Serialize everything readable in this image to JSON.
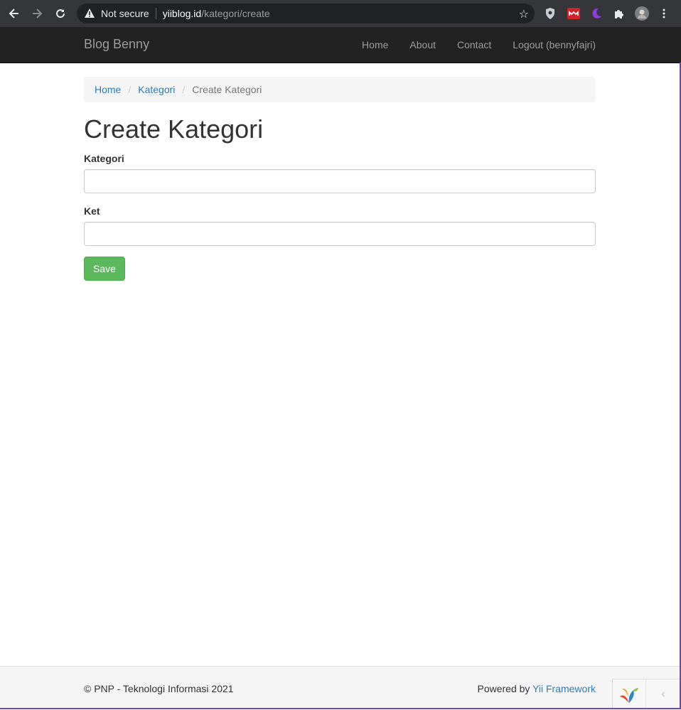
{
  "browser": {
    "security_label": "Not secure",
    "url_host": "yiiblog.id",
    "url_path": "/kategori/create"
  },
  "navbar": {
    "brand": "Blog Benny",
    "links": [
      "Home",
      "About",
      "Contact",
      "Logout (bennyfajri)"
    ]
  },
  "breadcrumb": {
    "items": [
      "Home",
      "Kategori"
    ],
    "active": "Create Kategori"
  },
  "page": {
    "title": "Create Kategori"
  },
  "form": {
    "kategori_label": "Kategori",
    "kategori_value": "",
    "ket_label": "Ket",
    "ket_value": "",
    "save_label": "Save"
  },
  "footer": {
    "copyright": "© PNP - Teknologi Informasi 2021",
    "powered_prefix": "Powered by ",
    "powered_link": "Yii Framework"
  },
  "colors": {
    "navbar_bg": "#222222",
    "link": "#337ab7",
    "save_button": "#5cb85c"
  }
}
